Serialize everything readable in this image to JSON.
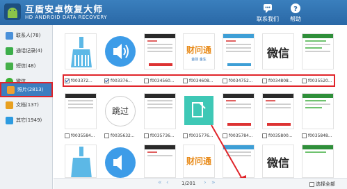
{
  "app": {
    "title": "互盾安卓恢复大师",
    "subtitle": "HD ANDROID DATA RECOVERY",
    "contact_label": "联系我们",
    "help_label": "帮助"
  },
  "sidebar": {
    "items": [
      {
        "label": "联系人(78)",
        "icon": "contact-icon",
        "color": "#4a90d9"
      },
      {
        "label": "通话记录(4)",
        "icon": "phone-icon",
        "color": "#3cae4a"
      },
      {
        "label": "短信(48)",
        "icon": "sms-icon",
        "color": "#46b04a"
      },
      {
        "label": "微信",
        "icon": "wechat-icon",
        "color": "#3cb034"
      },
      {
        "label": "照片(2813)",
        "icon": "photo-icon",
        "color": "#f0a030",
        "active": true
      },
      {
        "label": "文档(137)",
        "icon": "document-icon",
        "color": "#e8a020"
      },
      {
        "label": "其它(1949)",
        "icon": "other-icon",
        "color": "#2d9be0"
      }
    ]
  },
  "grid": {
    "row1": [
      "f003372...",
      "f003376...",
      "f0034560...",
      "f0034608...",
      "f0034752...",
      "f0034808...",
      "f0035520..."
    ],
    "row1_checked": [
      true,
      true,
      false,
      false,
      false,
      false,
      false
    ],
    "row2": [
      "f0035584...",
      "f0035632...",
      "f0035736...",
      "f0035776...",
      "f0035784...",
      "f0035800...",
      "f0035848..."
    ],
    "thumb_text": {
      "speech": "跳过",
      "brand": "财问通",
      "brand_sub": "金财 金生",
      "dark_word": "微信"
    }
  },
  "footer": {
    "page": "1/201",
    "select_all": "选择全部"
  },
  "colors": {
    "header": "#2f72b2",
    "accent_red": "#e0242a",
    "selection": "#3b7ec0"
  }
}
